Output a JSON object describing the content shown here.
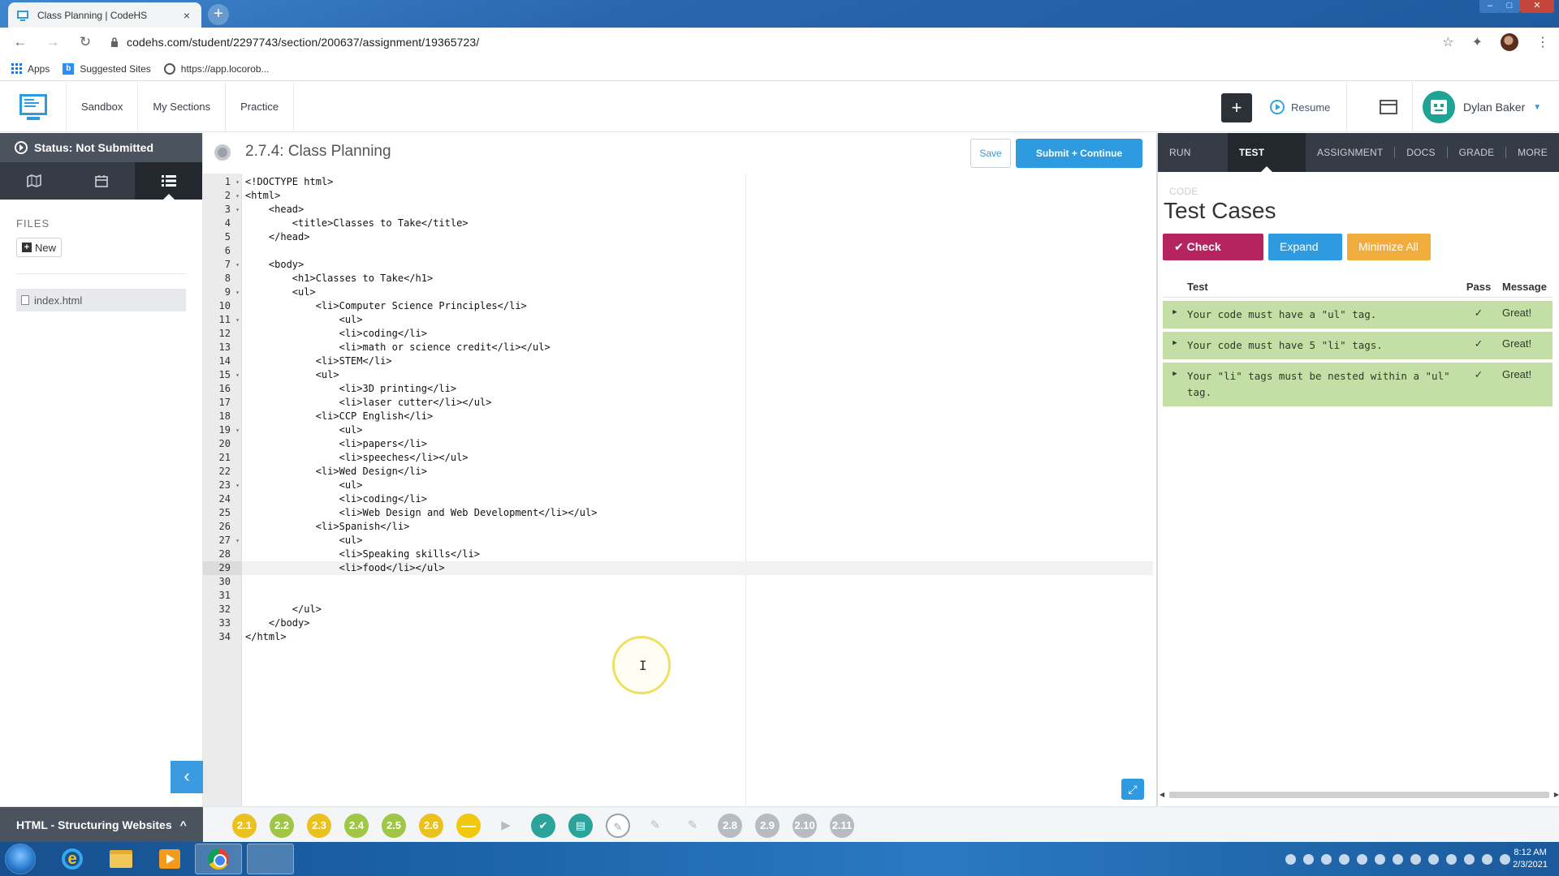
{
  "browser": {
    "tab_title": "Class Planning | CodeHS",
    "tab_close": "×",
    "new_tab": "+",
    "url": "codehs.com/student/2297743/section/200637/assignment/19365723/",
    "bookmarks": [
      "Apps",
      "Suggested Sites",
      "https://app.locorob..."
    ],
    "win_min": "–",
    "win_max": "□",
    "win_close": "✕"
  },
  "header": {
    "nav": [
      "Sandbox",
      "My Sections",
      "Practice"
    ],
    "plus_label": "+",
    "resume_label": "Resume",
    "user_name": "Dylan Baker"
  },
  "sidebar": {
    "status": "Status: Not Submitted",
    "files_label": "FILES",
    "new_label": "New",
    "file_name": "index.html",
    "collapse_glyph": "‹"
  },
  "editor": {
    "title": "2.7.4: Class Planning",
    "save_label": "Save",
    "submit_label": "Submit + Continue",
    "active_line": 29,
    "lines": [
      "<!DOCTYPE html>",
      "<html>",
      "    <head>",
      "        <title>Classes to Take</title>",
      "    </head>",
      "",
      "    <body>",
      "        <h1>Classes to Take</h1>",
      "        <ul>",
      "            <li>Computer Science Principles</li>",
      "                <ul>",
      "                <li>coding</li>",
      "                <li>math or science credit</li></ul>",
      "            <li>STEM</li>",
      "            <ul>",
      "                <li>3D printing</li>",
      "                <li>laser cutter</li></ul>",
      "            <li>CCP English</li>",
      "                <ul>",
      "                <li>papers</li>",
      "                <li>speeches</li></ul>",
      "            <li>Wed Design</li>",
      "                <ul>",
      "                <li>coding</li>",
      "                <li>Web Design and Web Development</li></ul>",
      "            <li>Spanish</li>",
      "                <ul>",
      "                <li>Speaking skills</li>",
      "                <li>food</li></ul>",
      "",
      "",
      "        </ul>",
      "    </body>",
      "</html>"
    ],
    "fold_lines": [
      1,
      2,
      3,
      7,
      9,
      11,
      15,
      19,
      23,
      27
    ]
  },
  "right_panel": {
    "tabs": [
      "RUN CODE",
      "TEST CASES",
      "ASSIGNMENT",
      "DOCS",
      "GRADE",
      "MORE"
    ],
    "active_tab": "TEST CASES",
    "title": "Test Cases",
    "check_code": "✔ Check Code",
    "expand_all": "Expand All",
    "minimize_all": "Minimize All",
    "columns": {
      "test": "Test",
      "pass": "Pass",
      "message": "Message"
    },
    "tests": [
      {
        "desc": "Your code must have a \"ul\" tag.",
        "pass": "✓",
        "message": "Great!"
      },
      {
        "desc": "Your code must have 5 \"li\" tags.",
        "pass": "✓",
        "message": "Great!"
      },
      {
        "desc": "Your \"li\" tags must be nested within a \"ul\" tag.",
        "pass": "✓",
        "message": "Great!"
      }
    ]
  },
  "bottom": {
    "unit_label": "HTML - Structuring Websites",
    "unit_caret": "^",
    "lessons": [
      {
        "label": "2.1",
        "style": "yellow"
      },
      {
        "label": "2.2",
        "style": "green"
      },
      {
        "label": "2.3",
        "style": "yellow"
      },
      {
        "label": "2.4",
        "style": "green"
      },
      {
        "label": "2.5",
        "style": "green"
      },
      {
        "label": "2.6",
        "style": "yellow"
      },
      {
        "label": "—",
        "style": "dash"
      },
      {
        "label": "▶",
        "style": "icon"
      },
      {
        "label": "✔",
        "style": "teal"
      },
      {
        "label": "▤",
        "style": "teal"
      },
      {
        "label": "✎",
        "style": "current"
      },
      {
        "label": "✎",
        "style": "icon"
      },
      {
        "label": "✎",
        "style": "icon"
      },
      {
        "label": "2.8",
        "style": "gray"
      },
      {
        "label": "2.9",
        "style": "gray"
      },
      {
        "label": "2.10",
        "style": "gray"
      },
      {
        "label": "2.11",
        "style": "gray"
      }
    ]
  },
  "taskbar": {
    "time": "8:12 AM",
    "date": "2/3/2021"
  }
}
